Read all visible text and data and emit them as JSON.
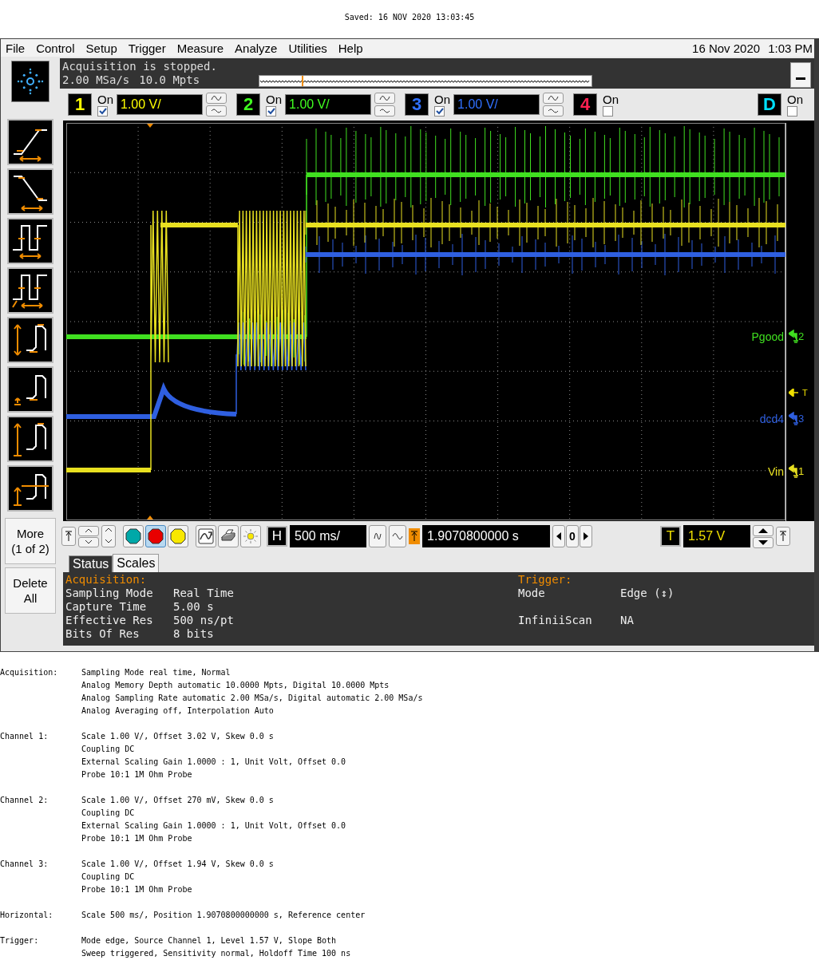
{
  "saved_line": "Saved: 16 NOV 2020 13:03:45",
  "menu": [
    "File",
    "Control",
    "Setup",
    "Trigger",
    "Measure",
    "Analyze",
    "Utilities",
    "Help"
  ],
  "clock": {
    "date": "16 Nov 2020",
    "time": "1:03 PM"
  },
  "banner": {
    "state": "Acquisition is stopped.",
    "rate": "2.00 MSa/s",
    "points": "10.0 Mpts"
  },
  "channels": [
    {
      "number": "1",
      "on_label": "On",
      "checked": true,
      "scale": "1.00 V/",
      "color": "#ffff00"
    },
    {
      "number": "2",
      "on_label": "On",
      "checked": true,
      "scale": "1.00 V/",
      "color": "#40ff20"
    },
    {
      "number": "3",
      "on_label": "On",
      "checked": true,
      "scale": "1.00 V/",
      "color": "#3070ff"
    },
    {
      "number": "4",
      "on_label": "On",
      "checked": false,
      "color": "#ff2050"
    },
    {
      "number": "D",
      "on_label": "On",
      "checked": false,
      "color": "#00e0ff"
    }
  ],
  "traces": [
    {
      "label": "Pgood",
      "marker": "2",
      "color": "#40e020"
    },
    {
      "label": "dcd4",
      "marker": "3",
      "color": "#2f5fe0"
    },
    {
      "label": "Vin",
      "marker": "1",
      "color": "#e8e020"
    }
  ],
  "trigger_marker": "T",
  "more_button": {
    "label": "More",
    "page": "(1 of 2)"
  },
  "delete_button": "Delete All",
  "run_buttons": [
    {
      "color": "#00a8a8",
      "selected": false
    },
    {
      "color": "#e80000",
      "selected": true
    },
    {
      "color": "#f8e800",
      "selected": false
    }
  ],
  "controls": {
    "horizontal_key": "H",
    "timebase": "500 ms/",
    "delay": "1.9070800000 s",
    "delay_ref": "0",
    "trigger_key": "T",
    "trigger_level": "1.57 V"
  },
  "tabs": [
    {
      "label": "Status",
      "selected": true
    },
    {
      "label": "Scales",
      "selected": false
    }
  ],
  "status": {
    "titles": [
      "Acquisition:",
      "Trigger:"
    ],
    "lines": [
      {
        "left": {
          "key": "Sampling Mode",
          "value": "Real Time"
        },
        "right": {
          "key": "Mode",
          "value": "Edge (↕)"
        }
      },
      {
        "left": {
          "key": "Capture Time",
          "value": "5.00 s"
        }
      },
      {
        "left": {
          "key": "Effective Res",
          "value": "500 ns/pt"
        },
        "right": {
          "key": "InfiniiScan",
          "value": "NA"
        }
      },
      {
        "left": {
          "key": "Bits Of Res",
          "value": "8 bits"
        }
      }
    ]
  },
  "report": [
    {
      "heading": "Acquisition:",
      "lines": [
        "Sampling Mode real time, Normal",
        "Analog Memory Depth automatic 10.0000 Mpts, Digital 10.0000 Mpts",
        "Analog Sampling Rate automatic 2.00 MSa/s, Digital automatic 2.00 MSa/s",
        "Analog Averaging off, Interpolation Auto"
      ]
    },
    {
      "heading": "Channel 1:",
      "lines": [
        "Scale 1.00 V/, Offset 3.02 V, Skew 0.0 s",
        "Coupling DC",
        "External Scaling Gain 1.0000 : 1, Unit Volt, Offset 0.0",
        "Probe 10:1 1M Ohm Probe"
      ]
    },
    {
      "heading": "Channel 2:",
      "lines": [
        "Scale 1.00 V/, Offset 270 mV, Skew 0.0 s",
        "Coupling DC",
        "External Scaling Gain 1.0000 : 1, Unit Volt, Offset 0.0",
        "Probe 10:1 1M Ohm Probe"
      ]
    },
    {
      "heading": "Channel 3:",
      "lines": [
        "Scale 1.00 V/, Offset 1.94 V, Skew 0.0 s",
        "Coupling DC",
        "Probe 10:1 1M Ohm Probe"
      ]
    },
    {
      "heading": "Horizontal:",
      "lines": [
        "Scale 500 ms/, Position 1.9070800000000 s, Reference center"
      ]
    },
    {
      "heading": "Trigger:",
      "lines": [
        "Mode edge, Source Channel 1, Level 1.57 V, Slope Both",
        "Sweep triggered, Sensitivity normal, Holdoff Time 100 ns"
      ]
    }
  ]
}
